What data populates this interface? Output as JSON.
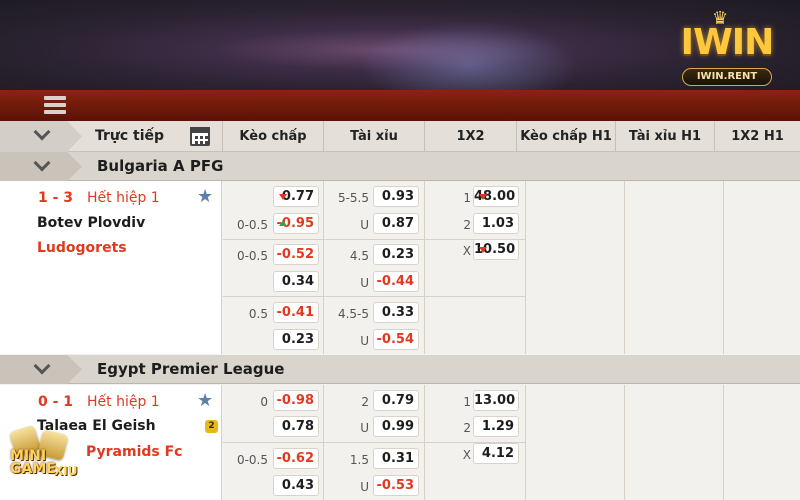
{
  "brand": {
    "logo_text": "IWIN",
    "logo_sub": "IWIN.RENT"
  },
  "header": {
    "live_label": "Trực tiếp",
    "columns": [
      "Kèo chấp",
      "Tài xỉu",
      "1X2",
      "Kèo chấp H1",
      "Tài xỉu H1",
      "1X2 H1"
    ]
  },
  "leagues": [
    {
      "name": "Bulgaria A PFG",
      "match": {
        "score": "1 - 3",
        "period": "Hết hiệp 1",
        "home": "Botev Plovdiv",
        "away": "Ludogorets",
        "handicap": [
          {
            "line": "",
            "odds": "0.77",
            "move": "down"
          },
          {
            "line": "0-0.5",
            "odds": "-0.95",
            "move": "up"
          },
          {
            "line": "0-0.5",
            "odds": "-0.52"
          },
          {
            "line": "",
            "odds": "0.34"
          },
          {
            "line": "0.5",
            "odds": "-0.41"
          },
          {
            "line": "",
            "odds": "0.23"
          }
        ],
        "total": [
          {
            "line": "5-5.5",
            "odds": "0.93"
          },
          {
            "line": "U",
            "odds": "0.87"
          },
          {
            "line": "4.5",
            "odds": "0.23"
          },
          {
            "line": "U",
            "odds": "-0.44"
          },
          {
            "line": "4.5-5",
            "odds": "0.33"
          },
          {
            "line": "U",
            "odds": "-0.54"
          }
        ],
        "onextwo": [
          {
            "label": "1",
            "odds": "48.00",
            "move": "down"
          },
          {
            "label": "2",
            "odds": "1.03"
          },
          {
            "label": "X",
            "odds": "10.50",
            "move": "down"
          }
        ]
      }
    },
    {
      "name": "Egypt Premier League",
      "match": {
        "score": "0 - 1",
        "period": "Hết hiệp 1",
        "home": "Talaea El Geish",
        "away": "Pyramids Fc",
        "home_badge": "2",
        "handicap": [
          {
            "line": "0",
            "odds": "-0.98"
          },
          {
            "line": "",
            "odds": "0.78"
          },
          {
            "line": "0-0.5",
            "odds": "-0.62"
          },
          {
            "line": "",
            "odds": "0.43"
          }
        ],
        "total": [
          {
            "line": "2",
            "odds": "0.79"
          },
          {
            "line": "U",
            "odds": "0.99"
          },
          {
            "line": "1.5",
            "odds": "0.31"
          },
          {
            "line": "U",
            "odds": "-0.53"
          }
        ],
        "onextwo": [
          {
            "label": "1",
            "odds": "13.00"
          },
          {
            "label": "2",
            "odds": "1.29"
          },
          {
            "label": "X",
            "odds": "4.12"
          }
        ]
      }
    }
  ],
  "minigame": {
    "line1": "MINI",
    "line2": "GAME",
    "line3": "XIU"
  },
  "colors": {
    "accent_red": "#e0391f",
    "menubar": "#7a1c0b",
    "odds_up": "#2fa84a"
  }
}
